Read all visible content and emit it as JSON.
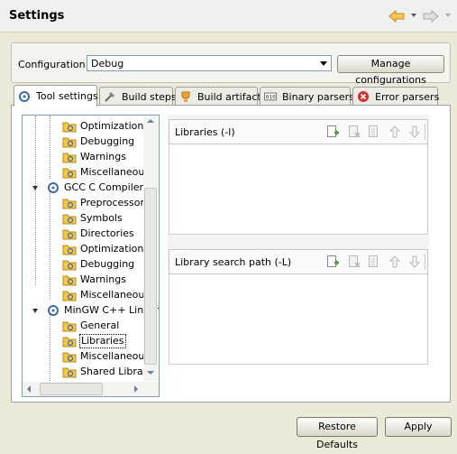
{
  "header": {
    "title": "Settings"
  },
  "configuration": {
    "label": "Configuration:",
    "value": "Debug",
    "manage_label": "Manage configurations"
  },
  "tabs": [
    {
      "label": "Tool settings",
      "icon": "tool-settings-icon",
      "active": true
    },
    {
      "label": "Build steps",
      "icon": "build-steps-icon",
      "active": false
    },
    {
      "label": "Build artifact",
      "icon": "build-artifact-icon",
      "active": false
    },
    {
      "label": "Binary parsers",
      "icon": "binary-parsers-icon",
      "active": false
    },
    {
      "label": "Error parsers",
      "icon": "error-parsers-icon",
      "active": false
    }
  ],
  "tree": {
    "items": [
      {
        "label": "Optimization",
        "level": 2,
        "kind": "folder"
      },
      {
        "label": "Debugging",
        "level": 2,
        "kind": "folder"
      },
      {
        "label": "Warnings",
        "level": 2,
        "kind": "folder"
      },
      {
        "label": "Miscellaneous",
        "level": 2,
        "kind": "folder"
      },
      {
        "label": "GCC C Compiler",
        "level": 1,
        "kind": "tool",
        "expanded": true
      },
      {
        "label": "Preprocessor",
        "level": 2,
        "kind": "folder"
      },
      {
        "label": "Symbols",
        "level": 2,
        "kind": "folder"
      },
      {
        "label": "Directories",
        "level": 2,
        "kind": "folder"
      },
      {
        "label": "Optimization",
        "level": 2,
        "kind": "folder"
      },
      {
        "label": "Debugging",
        "level": 2,
        "kind": "folder"
      },
      {
        "label": "Warnings",
        "level": 2,
        "kind": "folder"
      },
      {
        "label": "Miscellaneous",
        "level": 2,
        "kind": "folder"
      },
      {
        "label": "MinGW C++ Linker",
        "level": 1,
        "kind": "tool",
        "expanded": true
      },
      {
        "label": "General",
        "level": 2,
        "kind": "folder"
      },
      {
        "label": "Libraries",
        "level": 2,
        "kind": "folder",
        "selected": true
      },
      {
        "label": "Miscellaneous",
        "level": 2,
        "kind": "folder"
      },
      {
        "label": "Shared Library",
        "level": 2,
        "kind": "folder"
      }
    ]
  },
  "sections": [
    {
      "title": "Libraries (-l)"
    },
    {
      "title": "Library search path (-L)"
    }
  ],
  "toolbar_icons": [
    "add-icon",
    "delete-icon",
    "edit-icon",
    "move-up-icon",
    "move-down-icon"
  ],
  "buttons": {
    "restore_defaults": "Restore Defaults",
    "apply": "Apply"
  },
  "colors": {
    "accent_orange": "#e8a33a",
    "folder_yellow": "#f4c74a",
    "gear_blue": "#3a6cb0",
    "add_green": "#3aa03a",
    "error_red": "#d03030"
  }
}
